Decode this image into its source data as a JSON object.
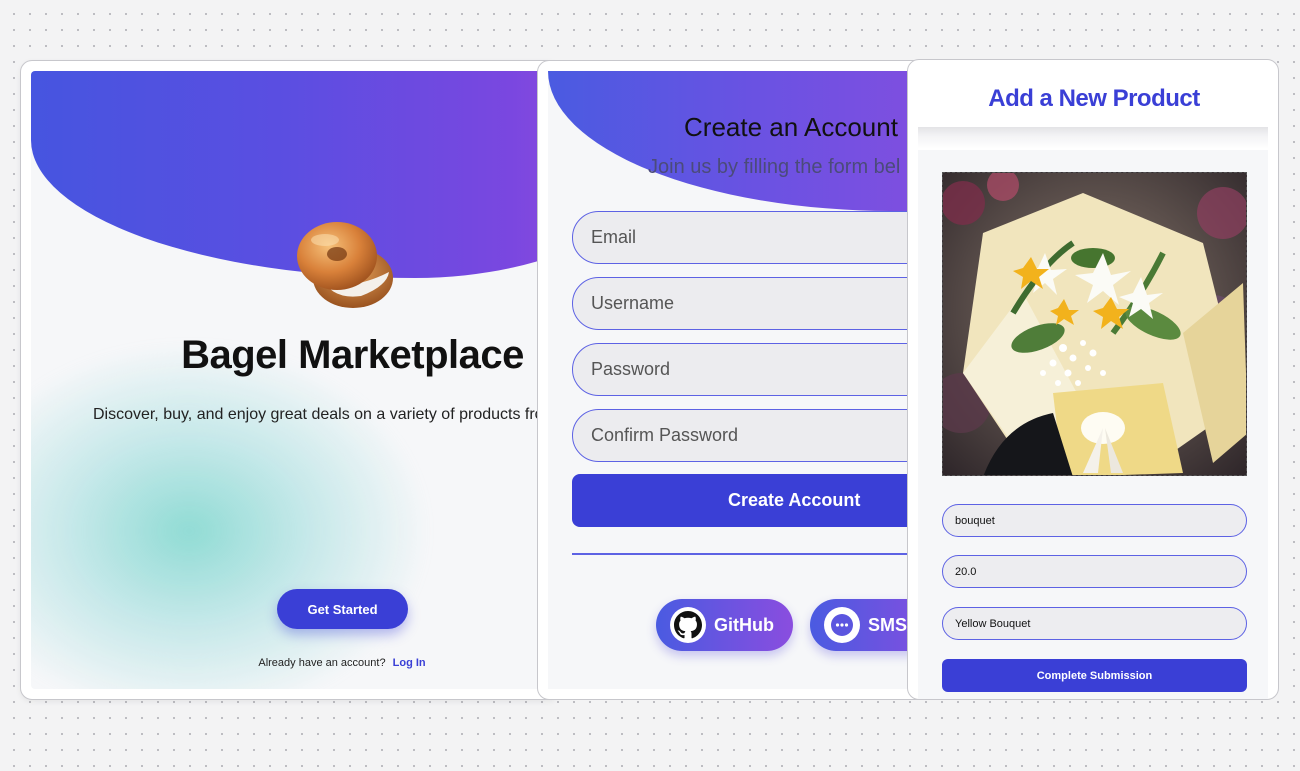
{
  "landing": {
    "title": "Bagel Marketplace",
    "description": "Discover, buy, and enjoy great deals on a variety of products from sellers!",
    "cta_label": "Get Started",
    "login_prompt": "Already have an account?",
    "login_link": "Log In",
    "logo_icon": "bagel-icon"
  },
  "signup": {
    "title": "Create an Account",
    "subtitle": "Join us by filling the form bel",
    "fields": {
      "email_placeholder": "Email",
      "username_placeholder": "Username",
      "password_placeholder": "Password",
      "confirm_placeholder": "Confirm Password"
    },
    "submit_label": "Create Account",
    "oauth": {
      "github_label": "GitHub",
      "github_icon": "github-icon",
      "sms_label": "SMS",
      "sms_icon": "chat-bubble-icon"
    }
  },
  "product": {
    "title": "Add a New Product",
    "image_icon": "bouquet-photo",
    "name_value": "bouquet",
    "price_value": "20.0",
    "description_value": "Yellow Bouquet",
    "submit_label": "Complete Submission"
  },
  "colors": {
    "primary": "#3a3fd6",
    "gradient_start": "#4655e0",
    "gradient_end": "#a24fd8",
    "field_border": "#5d62e4"
  }
}
